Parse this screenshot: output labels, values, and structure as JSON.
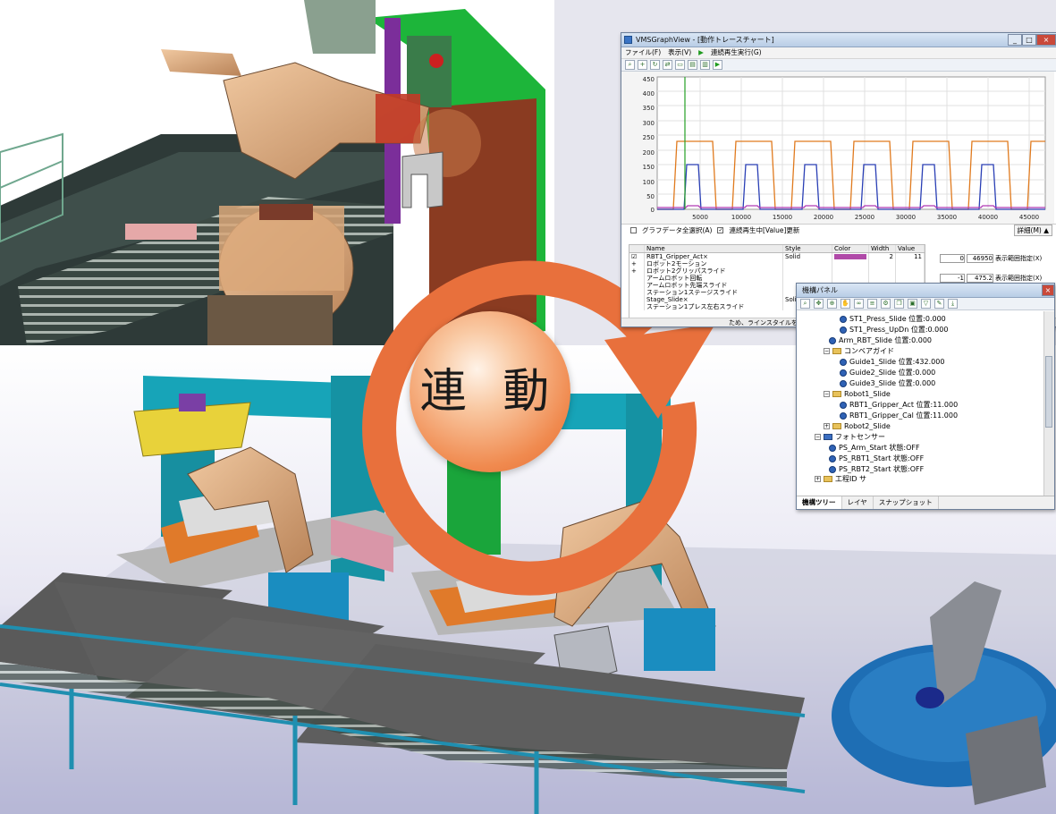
{
  "badge_text": "連 動",
  "graph_window": {
    "title": "VMSGraphView - [動作トレースチャート]",
    "window_buttons": [
      "_",
      "□",
      "×"
    ],
    "menu": [
      "ファイル(F)",
      "表示(V)",
      "連続再生実行(G)"
    ],
    "y_ticks": [
      "450",
      "400",
      "350",
      "300",
      "250",
      "200",
      "150",
      "100",
      "50",
      "0"
    ],
    "x_ticks": [
      "5000",
      "10000",
      "15000",
      "20000",
      "25000",
      "30000",
      "35000",
      "40000",
      "45000"
    ],
    "select_all_label": "グラフデータ全選択(A)",
    "update_label": "連続再生中[Value]更新",
    "details_label": "詳細(M)",
    "columns": [
      "Name",
      "Style",
      "Color",
      "Width",
      "Value"
    ],
    "rows": [
      {
        "name": "RBT1_Gripper_Act×",
        "style": "Solid",
        "width": "2",
        "value": "11"
      },
      {
        "name": "ロボット2モーション",
        "style": "",
        "width": "",
        "value": ""
      },
      {
        "name": "ロボット2グリッパスライド",
        "style": "",
        "width": "",
        "value": ""
      },
      {
        "name": "アームロボット回転",
        "style": "",
        "width": "",
        "value": ""
      },
      {
        "name": "アームロボット先端スライド",
        "style": "",
        "width": "",
        "value": ""
      },
      {
        "name": "ステーション1ステージスライド",
        "style": "",
        "width": "",
        "value": ""
      },
      {
        "name": "Stage_Slide×",
        "style": "Solid",
        "width": "",
        "value": ""
      },
      {
        "name": "ステーション1プレス左右スライド",
        "style": "",
        "width": "",
        "value": ""
      }
    ],
    "range_values": [
      {
        "min": "0",
        "max": "46950"
      },
      {
        "min": "-1",
        "max": "475.2"
      }
    ],
    "range_button": "表示範囲指定(X)",
    "status_text": "ため、ラインスタイルを [Solid] に設"
  },
  "mechanism_panel": {
    "title": "機構パネル",
    "items": [
      {
        "label": "ST1_Press_Slide 位置:0.000",
        "kind": "axis"
      },
      {
        "label": "ST1_Press_UpDn 位置:0.000",
        "kind": "axis"
      },
      {
        "label": "Arm_RBT_Slide 位置:0.000",
        "kind": "axis"
      },
      {
        "label": "コンベアガイド",
        "kind": "folder"
      },
      {
        "label": "Guide1_Slide 位置:432.000",
        "kind": "axis"
      },
      {
        "label": "Guide2_Slide 位置:0.000",
        "kind": "axis"
      },
      {
        "label": "Guide3_Slide 位置:0.000",
        "kind": "axis"
      },
      {
        "label": "Robot1_Slide",
        "kind": "folder"
      },
      {
        "label": "RBT1_Gripper_Act 位置:11.000",
        "kind": "axis"
      },
      {
        "label": "RBT1_Gripper_Cal 位置:11.000",
        "kind": "axis"
      },
      {
        "label": "Robot2_Slide",
        "kind": "folder"
      },
      {
        "label": "フォトセンサー",
        "kind": "folder"
      },
      {
        "label": "PS_Arm_Start 状態:OFF",
        "kind": "sensor"
      },
      {
        "label": "PS_RBT1_Start 状態:OFF",
        "kind": "sensor"
      },
      {
        "label": "PS_RBT2_Start 状態:OFF",
        "kind": "sensor"
      },
      {
        "label": "工程ID サ",
        "kind": "folder"
      }
    ],
    "tabs": [
      "機構ツリー",
      "レイヤ",
      "スナップショット"
    ]
  }
}
